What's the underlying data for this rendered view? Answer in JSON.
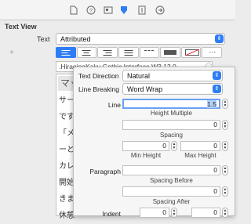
{
  "toolbar": {
    "icons": [
      "file-icon",
      "help-icon",
      "identity-icon",
      "attributes-icon",
      "size-icon",
      "connections-icon"
    ],
    "active": "attributes-icon",
    "accent": "#2f7df6"
  },
  "section_title": "Text View",
  "text_row": {
    "label": "Text",
    "value": "Attributed"
  },
  "font_field": ".HiraginoKaku Gothic Interface W3 12.0",
  "text_lines": [
    "マッ",
    "サー",
    "です",
    "「メ",
    "ーと",
    "カレ",
    "開始",
    "きま",
    "休憩"
  ],
  "paragraph_panel": {
    "text_direction_label": "Text Direction",
    "text_direction_value": "Natural",
    "line_breaking_label": "Line Breaking",
    "line_breaking_value": "Word Wrap",
    "line_label": "Line",
    "line_value": "1.5",
    "height_multiple_label": "Height Multiple",
    "spacing_value": "0",
    "spacing_label": "Spacing",
    "min_height_value": "0",
    "min_height_label": "Min Height",
    "max_height_value": "0",
    "max_height_label": "Max Height",
    "paragraph_label": "Paragraph",
    "spacing_before_value": "0",
    "spacing_before_label": "Spacing Before",
    "spacing_after_value": "0",
    "spacing_after_label": "Spacing After",
    "indent_label": "Indent",
    "indent_value_1": "0",
    "indent_value_2": "0"
  }
}
